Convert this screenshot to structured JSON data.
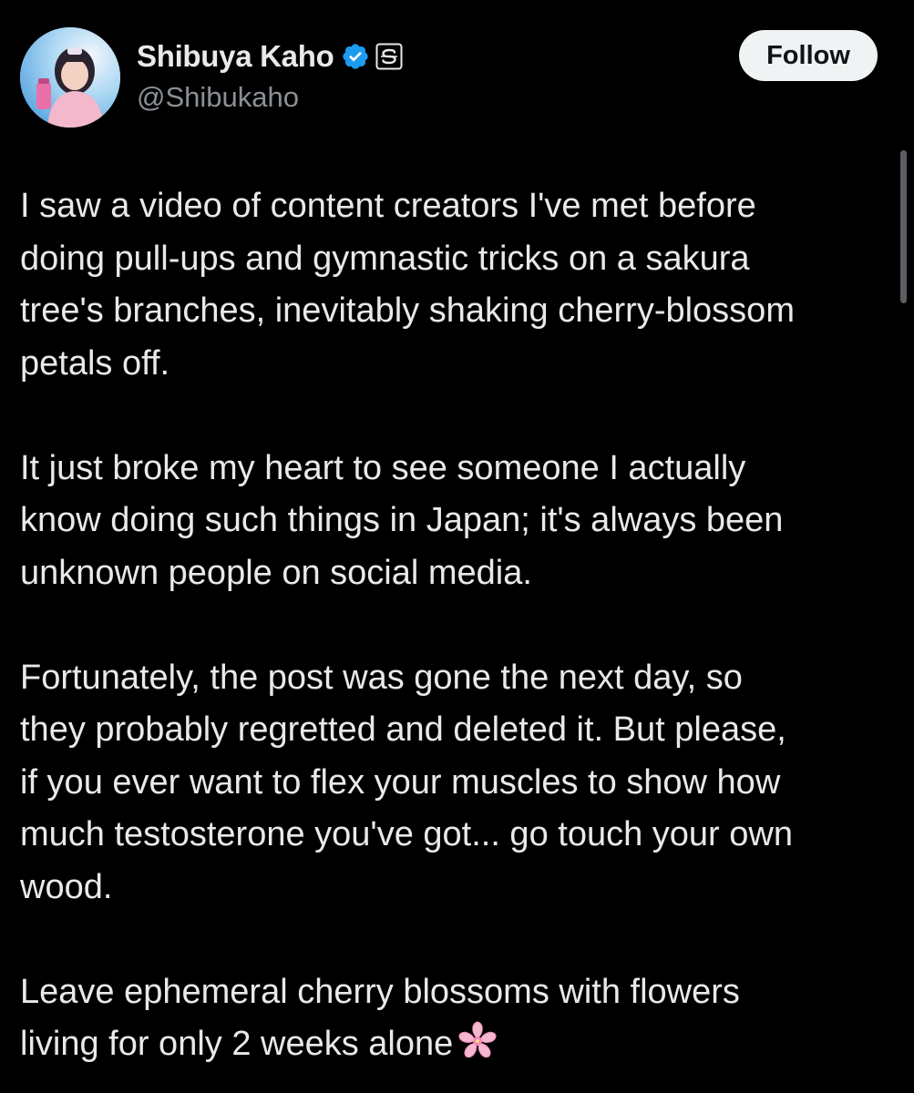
{
  "author": {
    "display_name": "Shibuya Kaho",
    "handle": "@Shibukaho",
    "verified_icon": "verified-badge-icon",
    "affiliate_icon": "affiliate-badge-icon"
  },
  "actions": {
    "follow_label": "Follow"
  },
  "tweet": {
    "paragraphs": [
      "I saw a video of content creators I've met before\ndoing pull-ups and gymnastic tricks on a sakura\ntree's branches, inevitably shaking cherry-blossom\npetals off.",
      "It just broke my heart to see someone I actually\nknow doing such things in Japan; it's always been\nunknown people on social media.",
      "Fortunately, the post was gone the next day, so\nthey probably regretted and deleted it. But please,\nif you ever want to flex your muscles to show how\nmuch testosterone you've got... go touch your own\nwood.",
      "Leave ephemeral cherry blossoms with flowers\nliving for only 2 weeks alone"
    ],
    "trailing_emoji": "cherry-blossom-icon"
  },
  "colors": {
    "background": "#000000",
    "text": "#e7e9ea",
    "secondary_text": "#8b9096",
    "verified_blue": "#1d9bf0",
    "follow_bg": "#eff3f4"
  }
}
